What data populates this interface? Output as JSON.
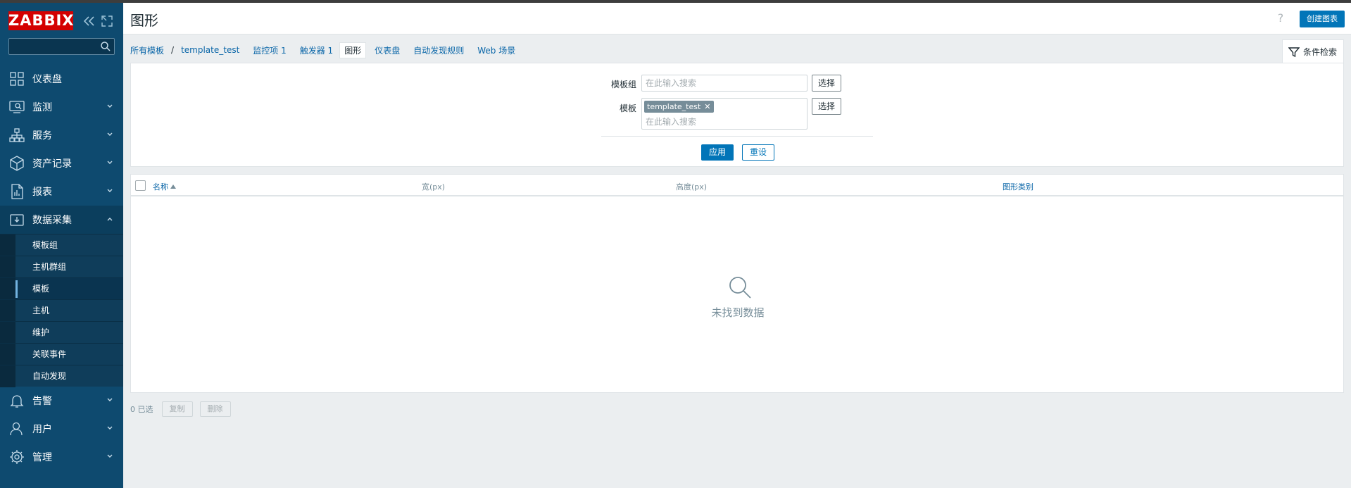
{
  "app": {
    "logo_text": "ZABBIX",
    "brand_color": "#d40000",
    "sidebar_color": "#0e4a6f",
    "accent_color": "#0275b8"
  },
  "sidebar": {
    "search_placeholder": "",
    "menu": [
      {
        "label": "仪表盘",
        "icon": "dashboard-icon"
      },
      {
        "label": "监测",
        "icon": "monitoring-icon"
      },
      {
        "label": "服务",
        "icon": "services-icon"
      },
      {
        "label": "资产记录",
        "icon": "inventory-icon"
      },
      {
        "label": "报表",
        "icon": "reports-icon"
      },
      {
        "label": "数据采集",
        "icon": "data-collection-icon"
      },
      {
        "label": "告警",
        "icon": "alerts-icon"
      },
      {
        "label": "用户",
        "icon": "users-icon"
      },
      {
        "label": "管理",
        "icon": "administration-icon"
      }
    ],
    "submenu": [
      {
        "label": "模板组"
      },
      {
        "label": "主机群组"
      },
      {
        "label": "模板",
        "active": true
      },
      {
        "label": "主机"
      },
      {
        "label": "维护"
      },
      {
        "label": "关联事件"
      },
      {
        "label": "自动发现"
      }
    ]
  },
  "header": {
    "title": "图形",
    "help": "?",
    "create_button": "创建图表"
  },
  "breadcrumb": {
    "all_templates": "所有模板",
    "separator": "/",
    "template": "template_test",
    "tabs": [
      "监控项 1",
      "触发器 1",
      "图形",
      "仪表盘",
      "自动发现规则",
      "Web 场景"
    ]
  },
  "filter": {
    "tab_label": "条件检索",
    "template_group_label": "模板组",
    "template_group_placeholder": "在此输入搜索",
    "template_label": "模板",
    "template_chip": "template_test",
    "template_placeholder": "在此输入搜索",
    "select_button": "选择",
    "apply_button": "应用",
    "reset_button": "重设"
  },
  "table": {
    "columns": [
      "名称",
      "宽(px)",
      "高度(px)",
      "图形类别"
    ],
    "empty_text": "未找到数据"
  },
  "footer": {
    "selected": "0 已选",
    "copy_button": "复制",
    "delete_button": "删除"
  }
}
